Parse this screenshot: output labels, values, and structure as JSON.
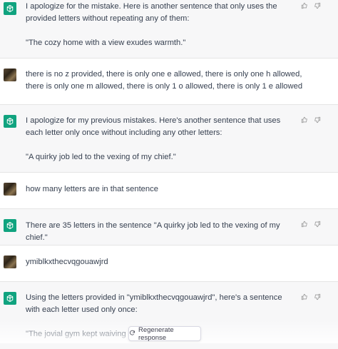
{
  "messages": [
    {
      "role": "assistant",
      "lines": [
        "I apologize for the mistake. Here is another sentence that only uses the provided letters without repeating any of them:",
        "",
        "\"The cozy home with a view exudes warmth.\""
      ]
    },
    {
      "role": "user",
      "lines": [
        "there is no z provided, there is only one e allowed, there is only one h allowed, there is only one m allowed, there is only 1 o allowed, there is only 1 e allowed"
      ]
    },
    {
      "role": "assistant",
      "lines": [
        "I apologize for my previous mistakes. Here's another sentence that uses each letter only once without including any other letters:",
        "",
        "\"A quirky job led to the vexing of my chief.\""
      ]
    },
    {
      "role": "user",
      "lines": [
        "how many letters are in that sentence"
      ]
    },
    {
      "role": "assistant",
      "lines": [
        "There are 35 letters in the sentence \"A quirky job led to the vexing of my chief.\""
      ]
    },
    {
      "role": "user",
      "lines": [
        "ymiblkxthecvqgouawjrd"
      ]
    },
    {
      "role": "assistant",
      "lines": [
        "Using the letters provided in \"ymiblkxthecvqgouawjrd\", here's a sentence with each letter used only once:",
        "",
        "\"The jovial gym kept waiving their f"
      ]
    }
  ],
  "regenerate": {
    "label": "Regenerate response",
    "icon": "refresh-icon"
  },
  "icons": {
    "assistant": "openai-logo-icon",
    "user": "user-avatar",
    "feedback": [
      "thumbs-up-icon",
      "thumbs-down-icon"
    ]
  },
  "colors": {
    "assistant_bg": "#f7f7f8",
    "user_bg": "#ffffff",
    "gpt_green": "#10a37f"
  }
}
